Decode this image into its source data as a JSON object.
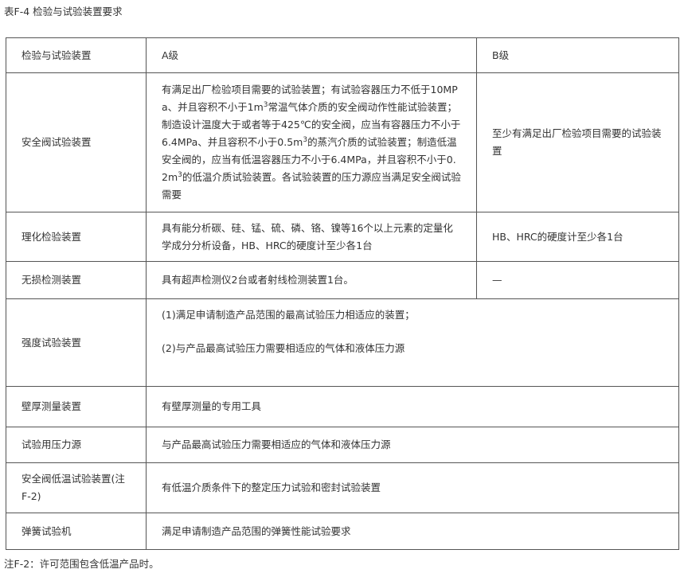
{
  "caption": "表F-4  检验与试验装置要求",
  "table": {
    "header": {
      "col1": "检验与试验装置",
      "col2": "A级",
      "col3": "B级"
    },
    "rows": {
      "safety_valve": {
        "name": "安全阀试验装置",
        "a_seg1": "有满足出厂检验项目需要的试验装置；有试验容器压力不低于10MPa、并且容积不小于1m",
        "a_sup1": "3",
        "a_seg2": "常温气体介质的安全阀动作性能试验装置；制造设计温度大于或者等于425℃的安全阀，应当有容器压力不小于6.4MPa、并且容积不小于0.5m",
        "a_sup2": "3",
        "a_seg3": "的蒸汽介质的试验装置；制造低温安全阀的，应当有低温容器压力不小于6.4MPa，并且容积不小于0.2m",
        "a_sup3": "3",
        "a_seg4": "的低温介质试验装置。各试验装置的压力源应当满足安全阀试验需要",
        "b": "至少有满足出厂检验项目需要的试验装置"
      },
      "phys_chem": {
        "name": "理化检验装置",
        "a": "具有能分析碳、硅、锰、硫、磷、铬、镍等16个以上元素的定量化学成分分析设备，HB、HRC的硬度计至少各1台",
        "b": "HB、HRC的硬度计至少各1台"
      },
      "ndt": {
        "name": "无损检测装置",
        "a": "具有超声检测仪2台或者射线检测装置1台。",
        "b": "—"
      },
      "strength": {
        "name": "强度试验装置",
        "a_line1": "(1)满足申请制造产品范围的最高试验压力相适应的装置；",
        "a_line2": "(2)与产品最高试验压力需要相适应的气体和液体压力源"
      },
      "wall": {
        "name": "壁厚测量装置",
        "a": "有壁厚测量的专用工具"
      },
      "pressure_source": {
        "name": "试验用压力源",
        "a": "与产品最高试验压力需要相适应的气体和液体压力源"
      },
      "low_temp": {
        "name": "安全阀低温试验装置(注F-2)",
        "a": "有低温介质条件下的整定压力试验和密封试验装置"
      },
      "spring": {
        "name": "弹簧试验机",
        "a": "满足申请制造产品范围的弹簧性能试验要求"
      }
    }
  },
  "footnote": "注F-2：许可范围包含低温产品时。"
}
